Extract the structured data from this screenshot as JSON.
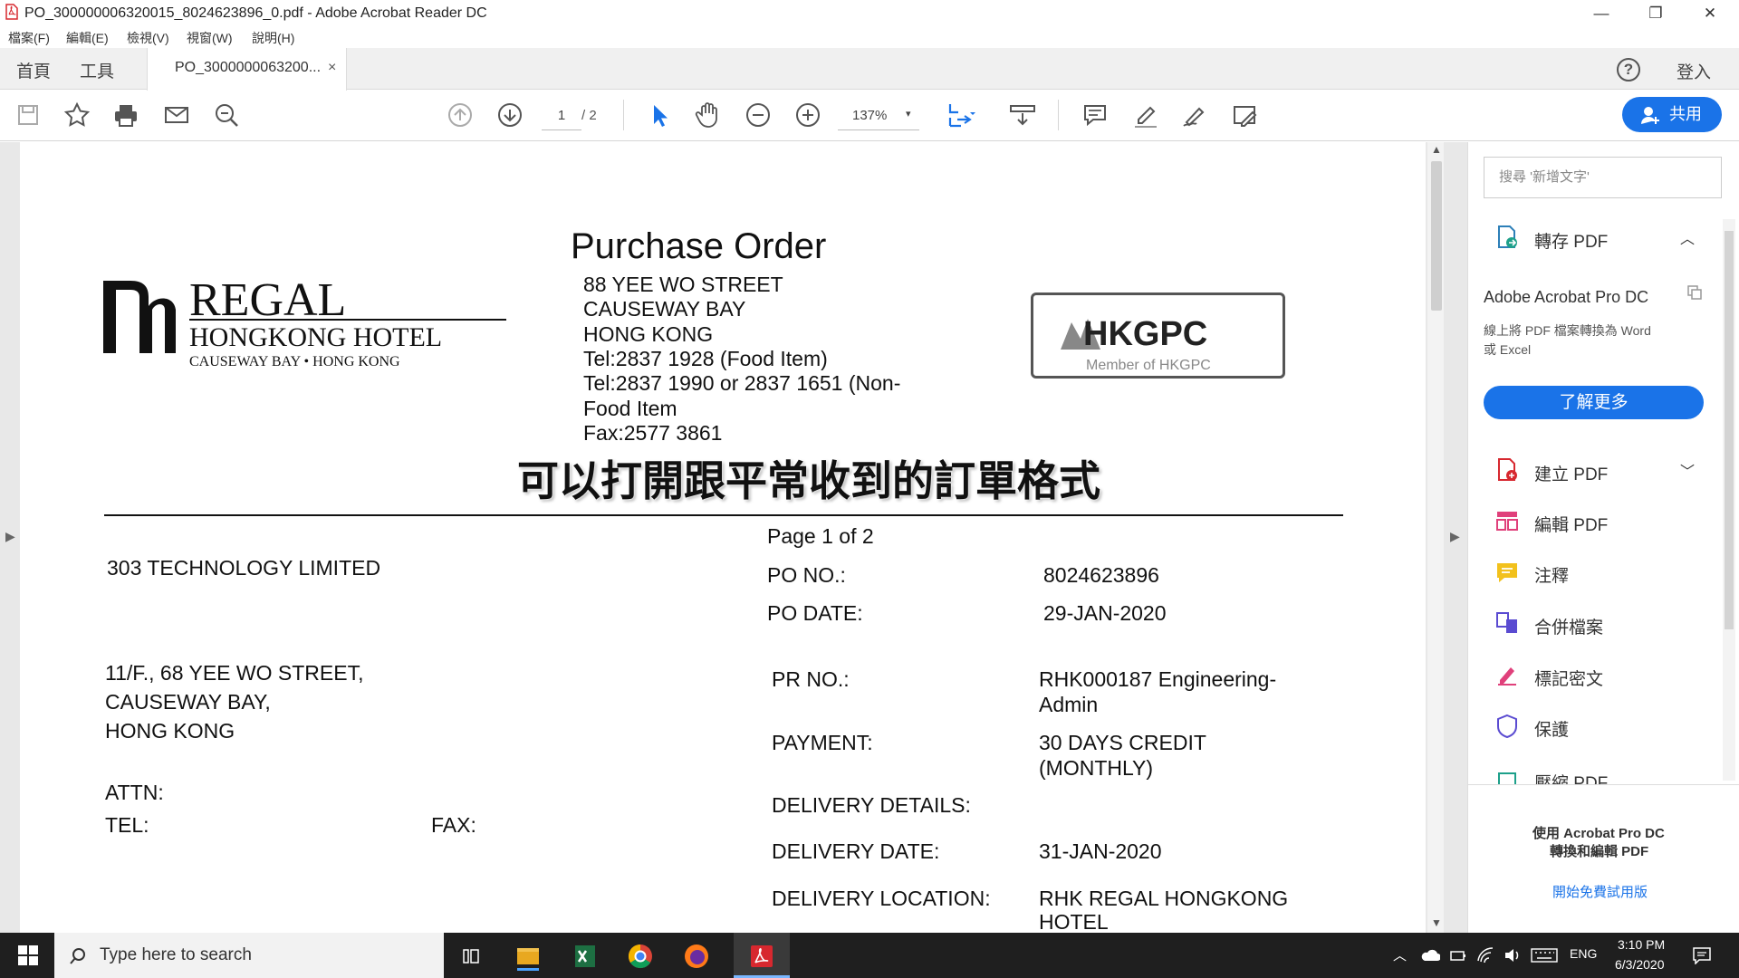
{
  "window": {
    "title": "PO_300000006320015_8024623896_0.pdf - Adobe Acrobat Reader DC",
    "minimize": "—",
    "restore": "❐",
    "close": "✕"
  },
  "menu": [
    "檔案(F)",
    "編輯(E)",
    "檢視(V)",
    "視窗(W)",
    "說明(H)"
  ],
  "tabs": {
    "home": "首頁",
    "tools": "工具",
    "document": "PO_3000000063200...",
    "close": "×",
    "help": "?",
    "signin": "登入"
  },
  "toolbar": {
    "page_current": "1",
    "page_total": "/ 2",
    "zoom": "137%",
    "zoom_caret": "▾",
    "share": "共用"
  },
  "document": {
    "title": "Purchase Order",
    "address": [
      "88 YEE WO STREET",
      "CAUSEWAY BAY",
      "HONG KONG",
      "Tel:2837 1928 (Food Item)",
      "Tel:2837  1990  or  2837  1651  (Non-",
      "Food Item",
      "Fax:2577 3861"
    ],
    "logo_regal": {
      "name": "REGAL",
      "sub": "HONGKONG HOTEL",
      "loc": "CAUSEWAY BAY • HONG KONG"
    },
    "logo_hkgpc": {
      "name": "HKGPC",
      "member": "Member of HKGPC"
    },
    "caption": "可以打開跟平常收到的訂單格式",
    "page_of": "Page 1 of 2",
    "vendor": "303 TECHNOLOGY LIMITED",
    "vendor_address": [
      "11/F., 68 YEE WO STREET,",
      "CAUSEWAY BAY,",
      "HONG KONG"
    ],
    "attn": "ATTN:",
    "tel": "TEL:",
    "fax": "FAX:",
    "po_no_label": "PO NO.:",
    "po_no": "8024623896",
    "po_date_label": "PO DATE:",
    "po_date": "29-JAN-2020",
    "pr_no_label": "PR NO.:",
    "pr_no": [
      "RHK000187 Engineering-",
      "Admin"
    ],
    "payment_label": "PAYMENT:",
    "payment": [
      "30 DAYS CREDIT",
      "(MONTHLY)"
    ],
    "delivery_details_label": "DELIVERY DETAILS:",
    "delivery_date_label": "DELIVERY DATE:",
    "delivery_date": "31-JAN-2020",
    "delivery_location_label": "DELIVERY LOCATION:",
    "delivery_location": [
      "RHK REGAL HONGKONG",
      "HOTEL"
    ]
  },
  "right_pane": {
    "search_placeholder": "搜尋 '新增文字'",
    "export_pdf": "轉存 PDF",
    "product": "Adobe Acrobat Pro DC",
    "promo": [
      "線上將 PDF 檔案轉換為 Word",
      "或 Excel"
    ],
    "learn_more": "了解更多",
    "tools": [
      "建立 PDF",
      "編輯 PDF",
      "注釋",
      "合併檔案",
      "標記密文",
      "保護",
      "壓縮 PDF"
    ],
    "footer": [
      "使用 Acrobat Pro DC",
      "轉換和編輯 PDF"
    ],
    "trial": "開始免費試用版"
  },
  "taskbar": {
    "search": "Type here to search",
    "lang": "ENG",
    "time": "3:10 PM",
    "date": "6/3/2020"
  },
  "colors": {
    "accent": "#1a73e8",
    "pdf_red": "#d7282f",
    "taskbar": "#1f1f1f"
  }
}
